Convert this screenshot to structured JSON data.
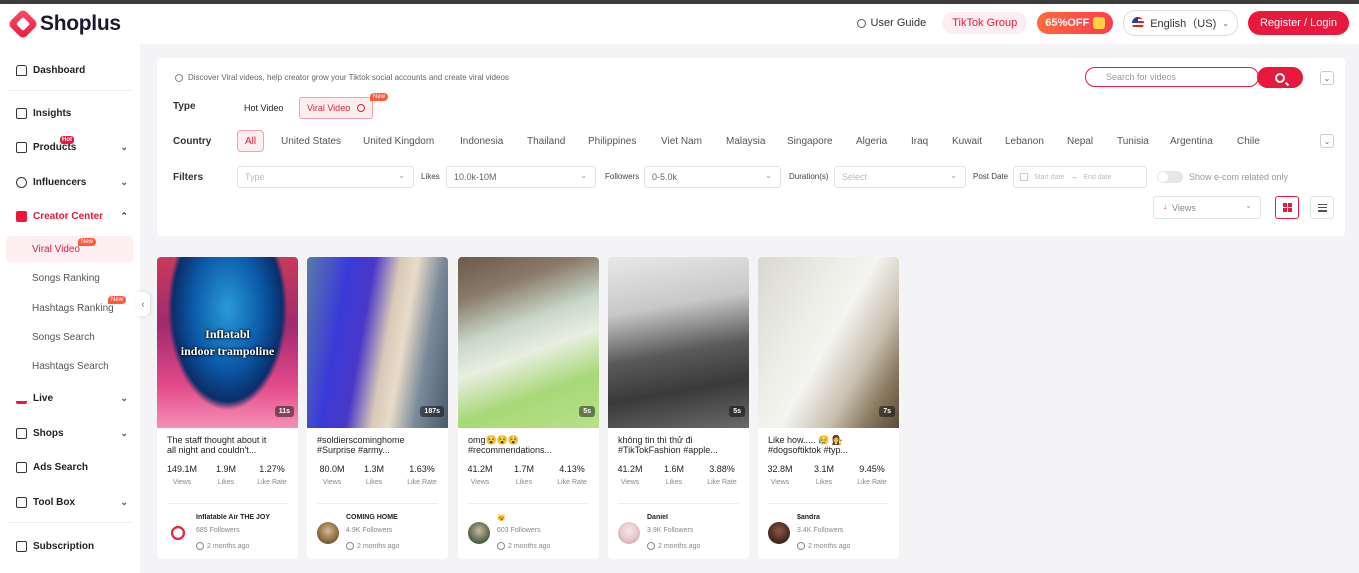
{
  "header": {
    "logo_text": "Shoplus",
    "user_guide": "User Guide",
    "tiktok_group": "TikTok Group",
    "promo": "65%OFF",
    "language": "English（US)",
    "register": "Register / Login"
  },
  "sidebar": {
    "dashboard": "Dashboard",
    "insights": "Insights",
    "products": "Products",
    "products_badge": "Hot",
    "influencers": "Influencers",
    "creator_center": "Creator Center",
    "viral_video": "Viral Video",
    "songs_ranking": "Songs Ranking",
    "hashtags_ranking": "Hashtags Ranking",
    "songs_search": "Songs Search",
    "hashtags_search": "Hashtags Search",
    "live": "Live",
    "shops": "Shops",
    "ads_search": "Ads Search",
    "tool_box": "Tool Box",
    "subscription": "Subscription",
    "new_badge": "New"
  },
  "filters": {
    "info": "Discover Viral videos, help creator grow your Tiktok social accounts and create viral videos",
    "search_placeholder": "Search for videos",
    "type_label": "Type",
    "type_hot": "Hot Video",
    "type_viral": "Viral Video",
    "type_new_badge": "New",
    "country_label": "Country",
    "countries": [
      "All",
      "United States",
      "United Kingdom",
      "Indonesia",
      "Thailand",
      "Philippines",
      "Viet Nam",
      "Malaysia",
      "Singapore",
      "Algeria",
      "Iraq",
      "Kuwait",
      "Lebanon",
      "Nepal",
      "Tunisia",
      "Argentina",
      "Chile"
    ],
    "filters_label": "Filters",
    "type_placeholder": "Type",
    "likes_label": "Likes",
    "likes_value": "10.0k-10M",
    "followers_label": "Followers",
    "followers_value": "0-5.0k",
    "duration_label": "Duration(s)",
    "duration_placeholder": "Select",
    "post_date_label": "Post Date",
    "start_date": "Start date",
    "end_date": "End date",
    "date_arrow": "→",
    "ecom_toggle": "Show e-com related only",
    "sort_value": "Views"
  },
  "stat_labels": {
    "views": "Views",
    "likes": "Likes",
    "like_rate": "Like Rate"
  },
  "videos": [
    {
      "duration": "11s",
      "overlay_1": "Inflatabl",
      "overlay_2": "indoor trampoline",
      "desc_1": "The staff thought about it",
      "desc_2": "all night and couldn't...",
      "views": "149.1M",
      "likes": "1.9M",
      "like_rate": "1.27%",
      "creator": "Inflatable Air THE JOY",
      "followers": "685 Followers",
      "time": "2 months ago"
    },
    {
      "duration": "187s",
      "overlay_1": "",
      "overlay_2": "",
      "desc_1": "#soldierscominghome",
      "desc_2": "#Surprise #army...",
      "views": "80.0M",
      "likes": "1.3M",
      "like_rate": "1.63%",
      "creator": "COMING HOME",
      "followers": "4.9K Followers",
      "time": "2 months ago"
    },
    {
      "duration": "5s",
      "overlay_1": "",
      "overlay_2": "",
      "desc_1": "omg😵😵😵",
      "desc_2": "#recommendations...",
      "views": "41.2M",
      "likes": "1.7M",
      "like_rate": "4.13%",
      "creator": "😼",
      "followers": "603 Followers",
      "time": "2 months ago"
    },
    {
      "duration": "5s",
      "overlay_1": "",
      "overlay_2": "",
      "desc_1": "không tin thì thử đi",
      "desc_2": "#TikTokFashion #apple...",
      "views": "41.2M",
      "likes": "1.6M",
      "like_rate": "3.88%",
      "creator": "Daniel",
      "followers": "3.9K Followers",
      "time": "2 months ago"
    },
    {
      "duration": "7s",
      "overlay_1": "",
      "overlay_2": "",
      "desc_1": "Like how..... 😥 👩‍⚖️",
      "desc_2": "#dogsoftiktok #typ...",
      "views": "32.8M",
      "likes": "3.1M",
      "like_rate": "9.45%",
      "creator": "$andra",
      "followers": "3.4K Followers",
      "time": "2 months ago"
    }
  ],
  "colors": {
    "accent": "#e8193c",
    "accent_light": "#fdeef0"
  }
}
